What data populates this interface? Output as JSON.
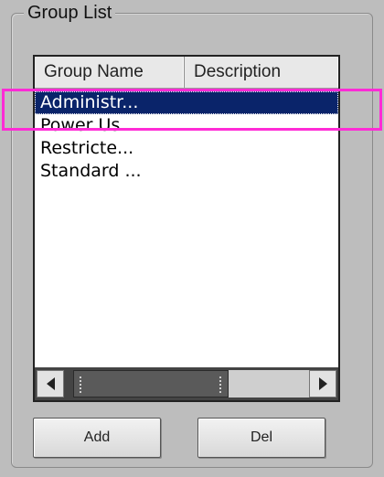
{
  "group_box": {
    "title": "Group List"
  },
  "list": {
    "columns": [
      "Group Name",
      "Description"
    ],
    "rows": [
      {
        "name": "Administr...",
        "description": "",
        "selected": true
      },
      {
        "name": "Power Us...",
        "description": "",
        "selected": false
      },
      {
        "name": "Restricte...",
        "description": "",
        "selected": false
      },
      {
        "name": "Standard ...",
        "description": "",
        "selected": false
      }
    ]
  },
  "buttons": {
    "add_label": "Add",
    "del_label": "Del"
  },
  "colors": {
    "selection": "#0a246a",
    "highlight": "#ff2bd6",
    "background": "#bdbdbd"
  },
  "icons": {
    "scroll_left": "triangle-left-icon",
    "scroll_right": "triangle-right-icon"
  }
}
